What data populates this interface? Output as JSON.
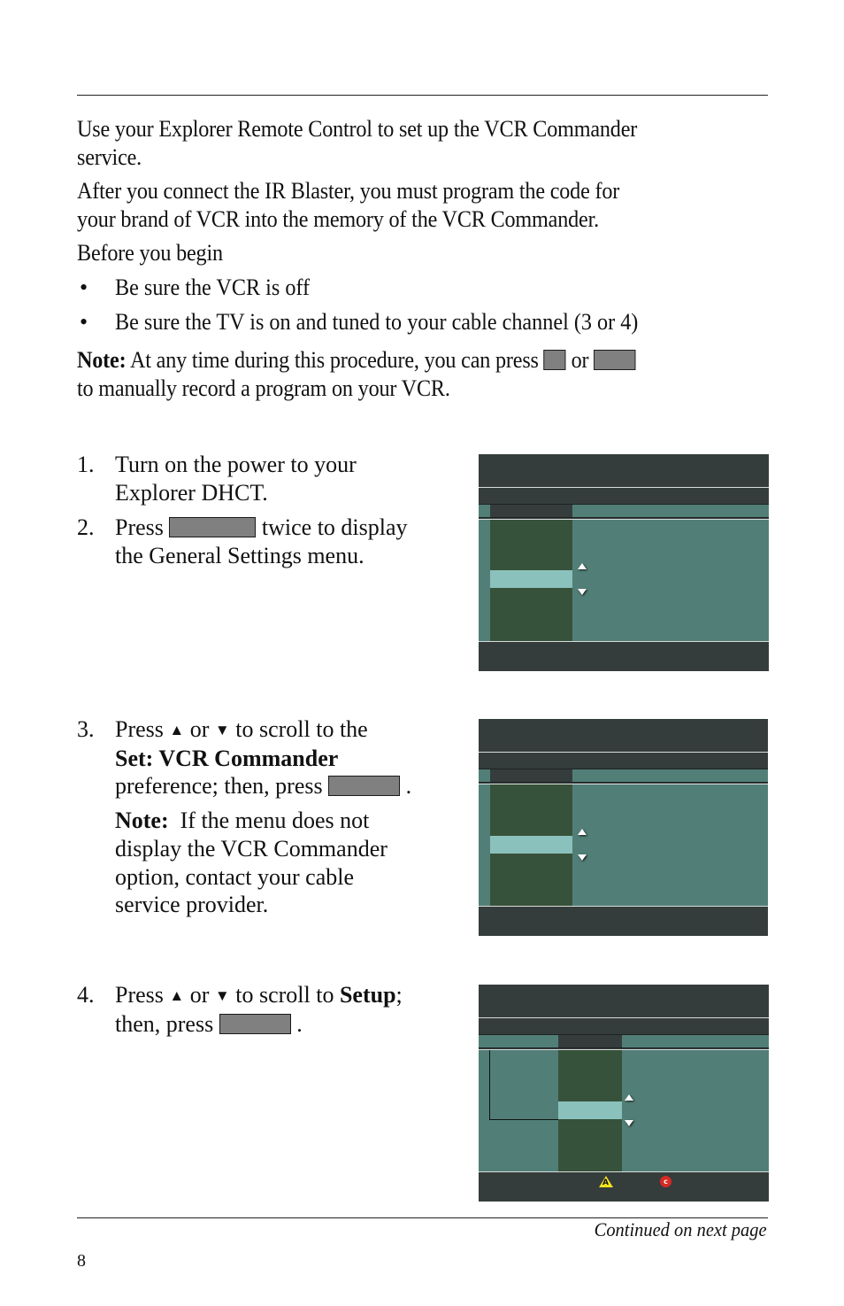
{
  "intro": {
    "p1": "Use your Explorer Remote Control to set up the VCR Commander service.",
    "p1_line1": "Use your Explorer Remote Control to set up the VCR Commander",
    "p1_line2": "service.",
    "p2_line1": "After you connect the IR Blaster, you must program the code for",
    "p2_line2": "your brand of VCR into the memory of the VCR Commander.",
    "before_heading": "Before you begin",
    "bullets": [
      "Be sure the VCR is off",
      "Be sure the TV is on and tuned to your cable channel (3 or 4)"
    ],
    "bullet_glyph": "•",
    "note_label": "Note:",
    "note_part1": " At any time during this procedure, you can press ",
    "note_or": " or ",
    "note_line2": "to manually record a program on your VCR."
  },
  "steps": [
    {
      "num": "1.",
      "line1": "Turn on the power to your",
      "line2": "Explorer DHCT."
    },
    {
      "num": "2.",
      "press": "Press ",
      "after_key": " twice to display",
      "line2": "the General Settings menu."
    },
    {
      "num": "3.",
      "line1_a": "Press ",
      "up": "▲",
      "or": " or ",
      "down": "▼",
      "line1_b": " to scroll to the",
      "bold_line": "Set: VCR Commander",
      "line3_a": "preference; then, press ",
      "line3_b": " .",
      "note_label": "Note:",
      "note_text_1": "  If the menu does not",
      "note_text_2": "display the VCR Commander",
      "note_text_3": "option, contact your cable",
      "note_text_4": "service provider."
    },
    {
      "num": "4.",
      "line1_a": "Press ",
      "up": "▲",
      "or": " or ",
      "down": "▼",
      "line1_b": " to scroll to ",
      "bold": "Setup",
      "line1_c": ";",
      "line2_a": "then, press ",
      "line2_b": " ."
    }
  ],
  "screens": {
    "colors": {
      "frame": "#353d3c",
      "panel": "#517f77",
      "list": "#37523a",
      "selected": "#8bc1bc"
    },
    "icons": {
      "a_button_label": "A",
      "c_button_label": "c"
    }
  },
  "footer": {
    "continued": "Continued on next page",
    "page_number": "8"
  }
}
